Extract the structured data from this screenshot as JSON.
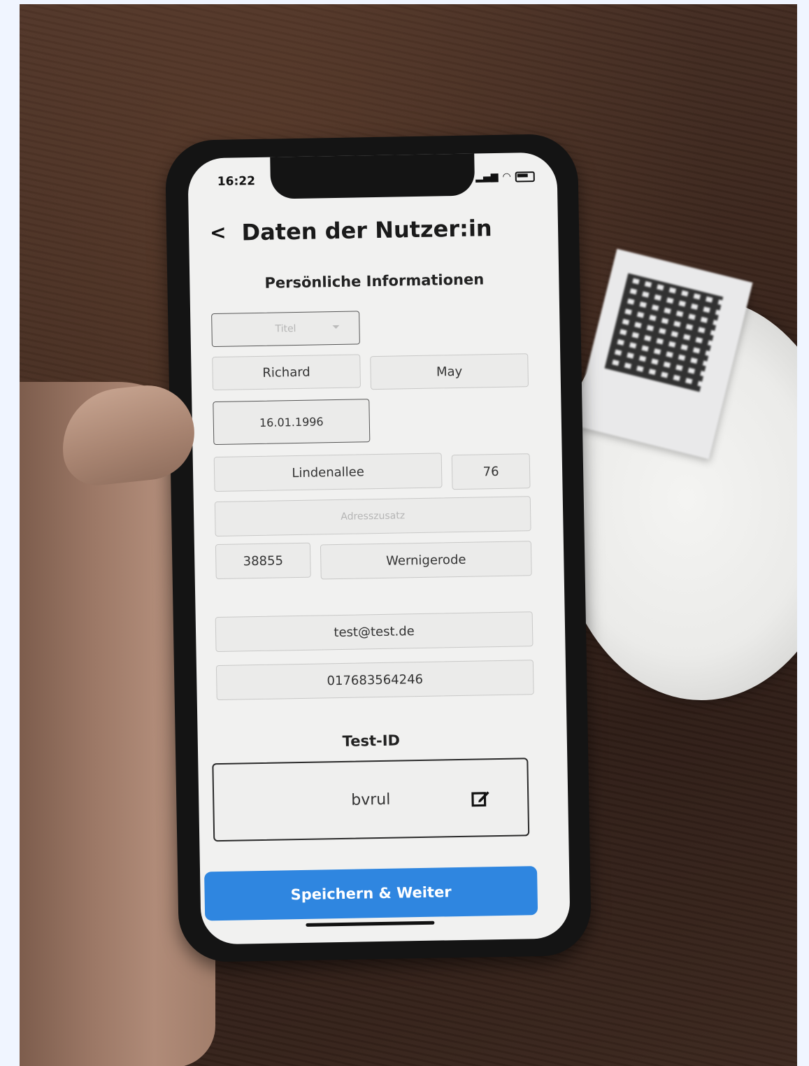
{
  "status_bar": {
    "time": "16:22"
  },
  "header": {
    "back_icon": "chevron-left-icon",
    "title": "Daten der Nutzer:in"
  },
  "personal": {
    "section_title": "Persönliche Informationen",
    "title_select_placeholder": "Titel",
    "first_name": "Richard",
    "last_name": "May",
    "birth_date": "16.01.1996",
    "street": "Lindenallee",
    "house_number": "76",
    "address_extra_placeholder": "Adresszusatz",
    "postal_code": "38855",
    "city": "Wernigerode",
    "email": "test@test.de",
    "phone": "017683564246"
  },
  "test": {
    "section_title": "Test-ID",
    "id_value": "bvrul",
    "edit_icon": "edit-icon"
  },
  "actions": {
    "save_label": "Speichern & Weiter"
  },
  "colors": {
    "primary_button": "#2f86e0",
    "screen_bg": "#f1f1f0"
  }
}
